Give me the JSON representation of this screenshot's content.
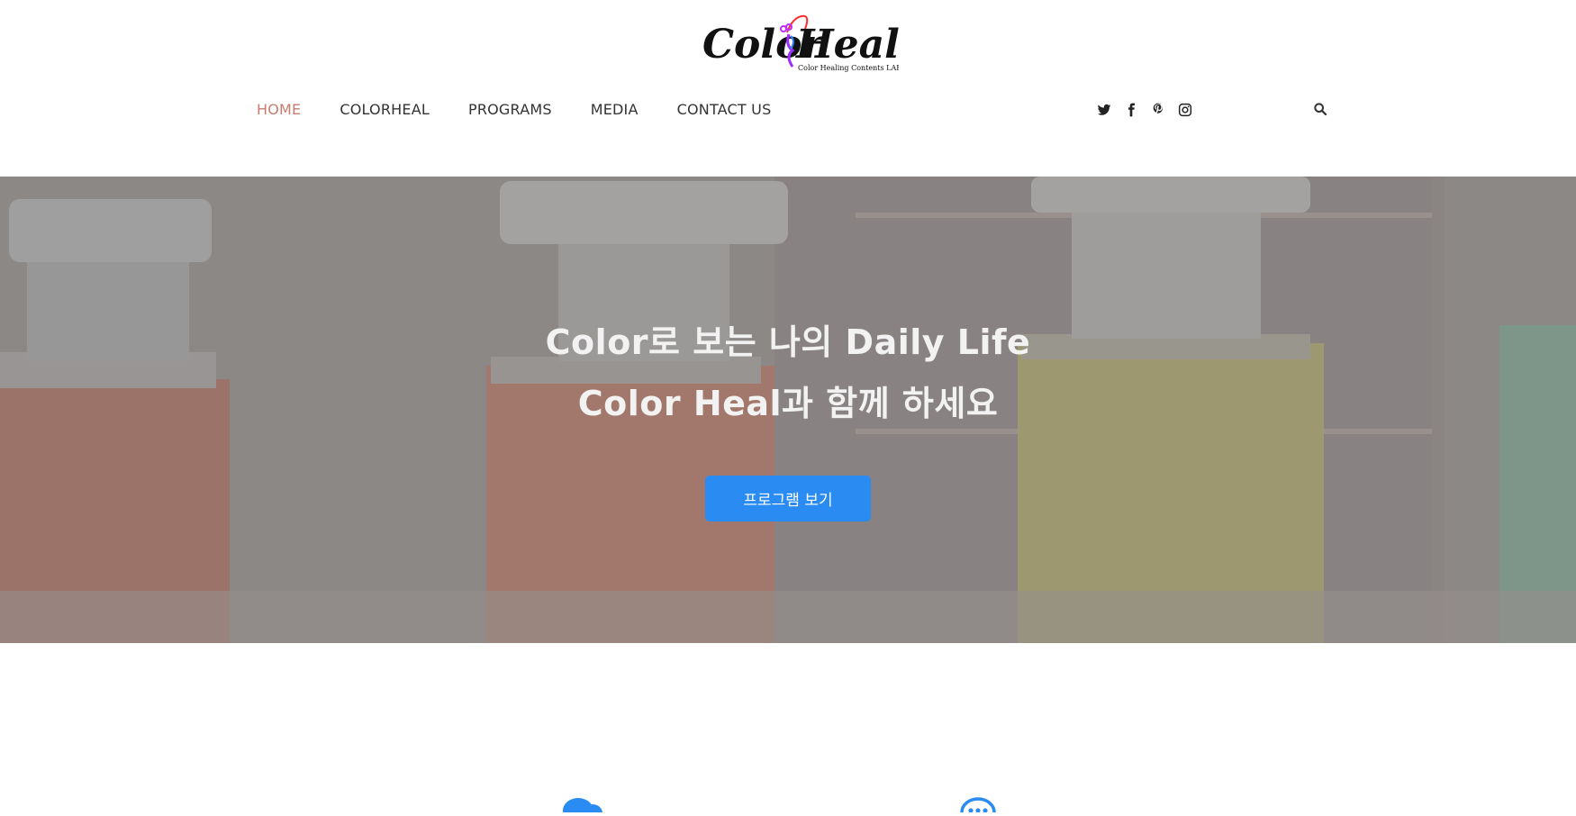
{
  "brand": {
    "logo_text": "ColorHeal",
    "logo_subtitle": "Color Healing Contents LAB"
  },
  "nav": {
    "items": [
      {
        "label": "HOME",
        "active": true
      },
      {
        "label": "COLORHEAL",
        "active": false
      },
      {
        "label": "PROGRAMS",
        "active": false
      },
      {
        "label": "MEDIA",
        "active": false
      },
      {
        "label": "CONTACT US",
        "active": false
      }
    ],
    "active_color": "#c87c6e"
  },
  "social": {
    "icons": [
      "twitter-icon",
      "facebook-icon",
      "pinterest-icon",
      "instagram-icon"
    ]
  },
  "search": {
    "icon": "search-icon"
  },
  "hero": {
    "line1": "Color로 보는 나의 Daily Life",
    "line2": "Color Heal과 함께 하세요",
    "button_label": "프로그램 보기",
    "button_color": "#2a8cf2"
  },
  "features": {
    "icons": [
      "chat-bubbles-icon",
      "comment-dots-icon"
    ],
    "icon_color": "#2a8cf2"
  }
}
